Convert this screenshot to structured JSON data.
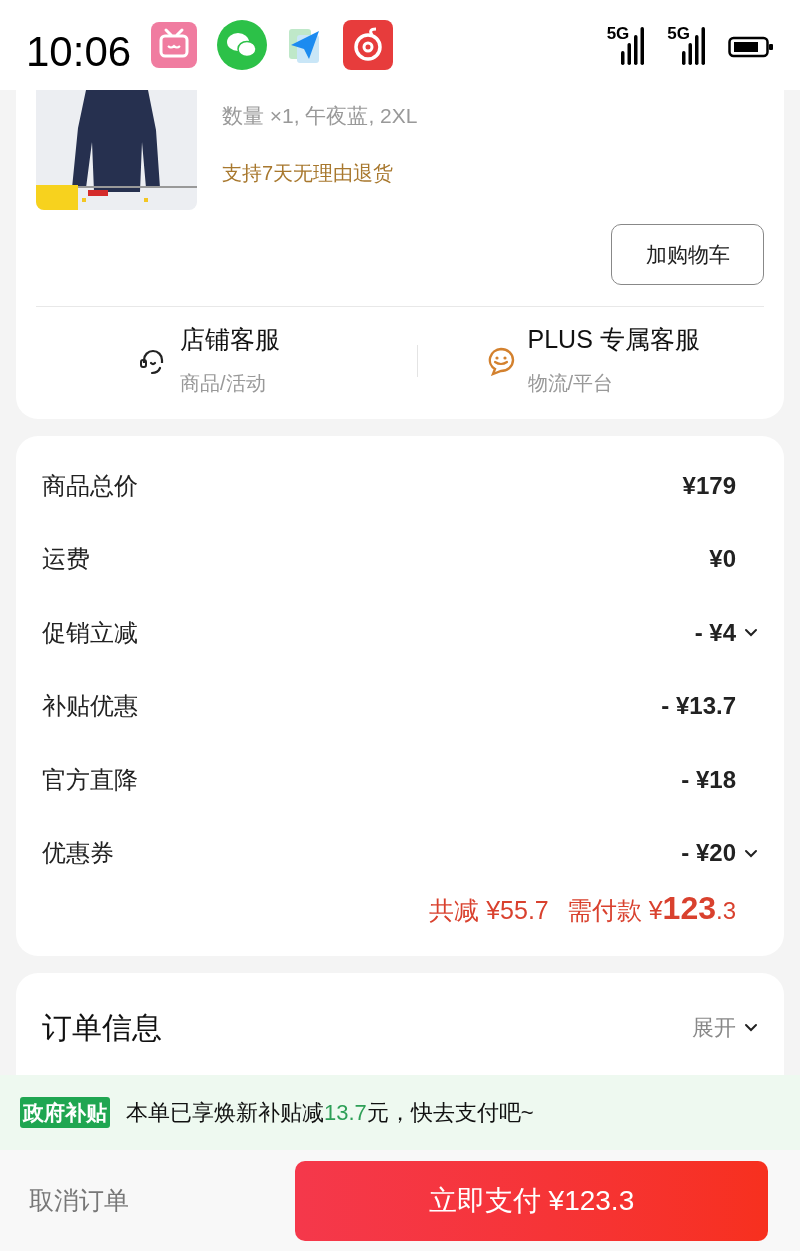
{
  "status_bar": {
    "time": "10:06",
    "networks": [
      "5G",
      "5G"
    ]
  },
  "product": {
    "spec": "数量 ×1, 午夜蓝, 2XL",
    "return_policy": "支持7天无理由退货",
    "cart_button": "加购物车"
  },
  "services": [
    {
      "kind": "store",
      "title": "店铺客服",
      "subtitle": "商品/活动"
    },
    {
      "kind": "plus",
      "title": "PLUS 专属客服",
      "subtitle": "物流/平台"
    }
  ],
  "price_rows": [
    {
      "label": "商品总价",
      "value": "¥179",
      "expandable": false
    },
    {
      "label": "运费",
      "value": "¥0",
      "expandable": false
    },
    {
      "label": "促销立减",
      "value": "- ¥4",
      "expandable": true
    },
    {
      "label": "补贴优惠",
      "value": "- ¥13.7",
      "expandable": false
    },
    {
      "label": "官方直降",
      "value": "- ¥18",
      "expandable": false
    },
    {
      "label": "优惠券",
      "value": "- ¥20",
      "expandable": true
    }
  ],
  "summary": {
    "discount": "共减 ¥55.7",
    "pay_label": "需付款",
    "currency": "¥",
    "integer": "123",
    "decimal": ".3"
  },
  "order_info": {
    "title": "订单信息",
    "toggle": "展开"
  },
  "notice": {
    "badge": "政府补贴",
    "before": "本单已享焕新补贴减",
    "highlight": "13.7",
    "after": "元，快去支付吧~"
  },
  "bottom_bar": {
    "cancel": "取消订单",
    "pay_button": "立即支付 ¥123.3"
  }
}
